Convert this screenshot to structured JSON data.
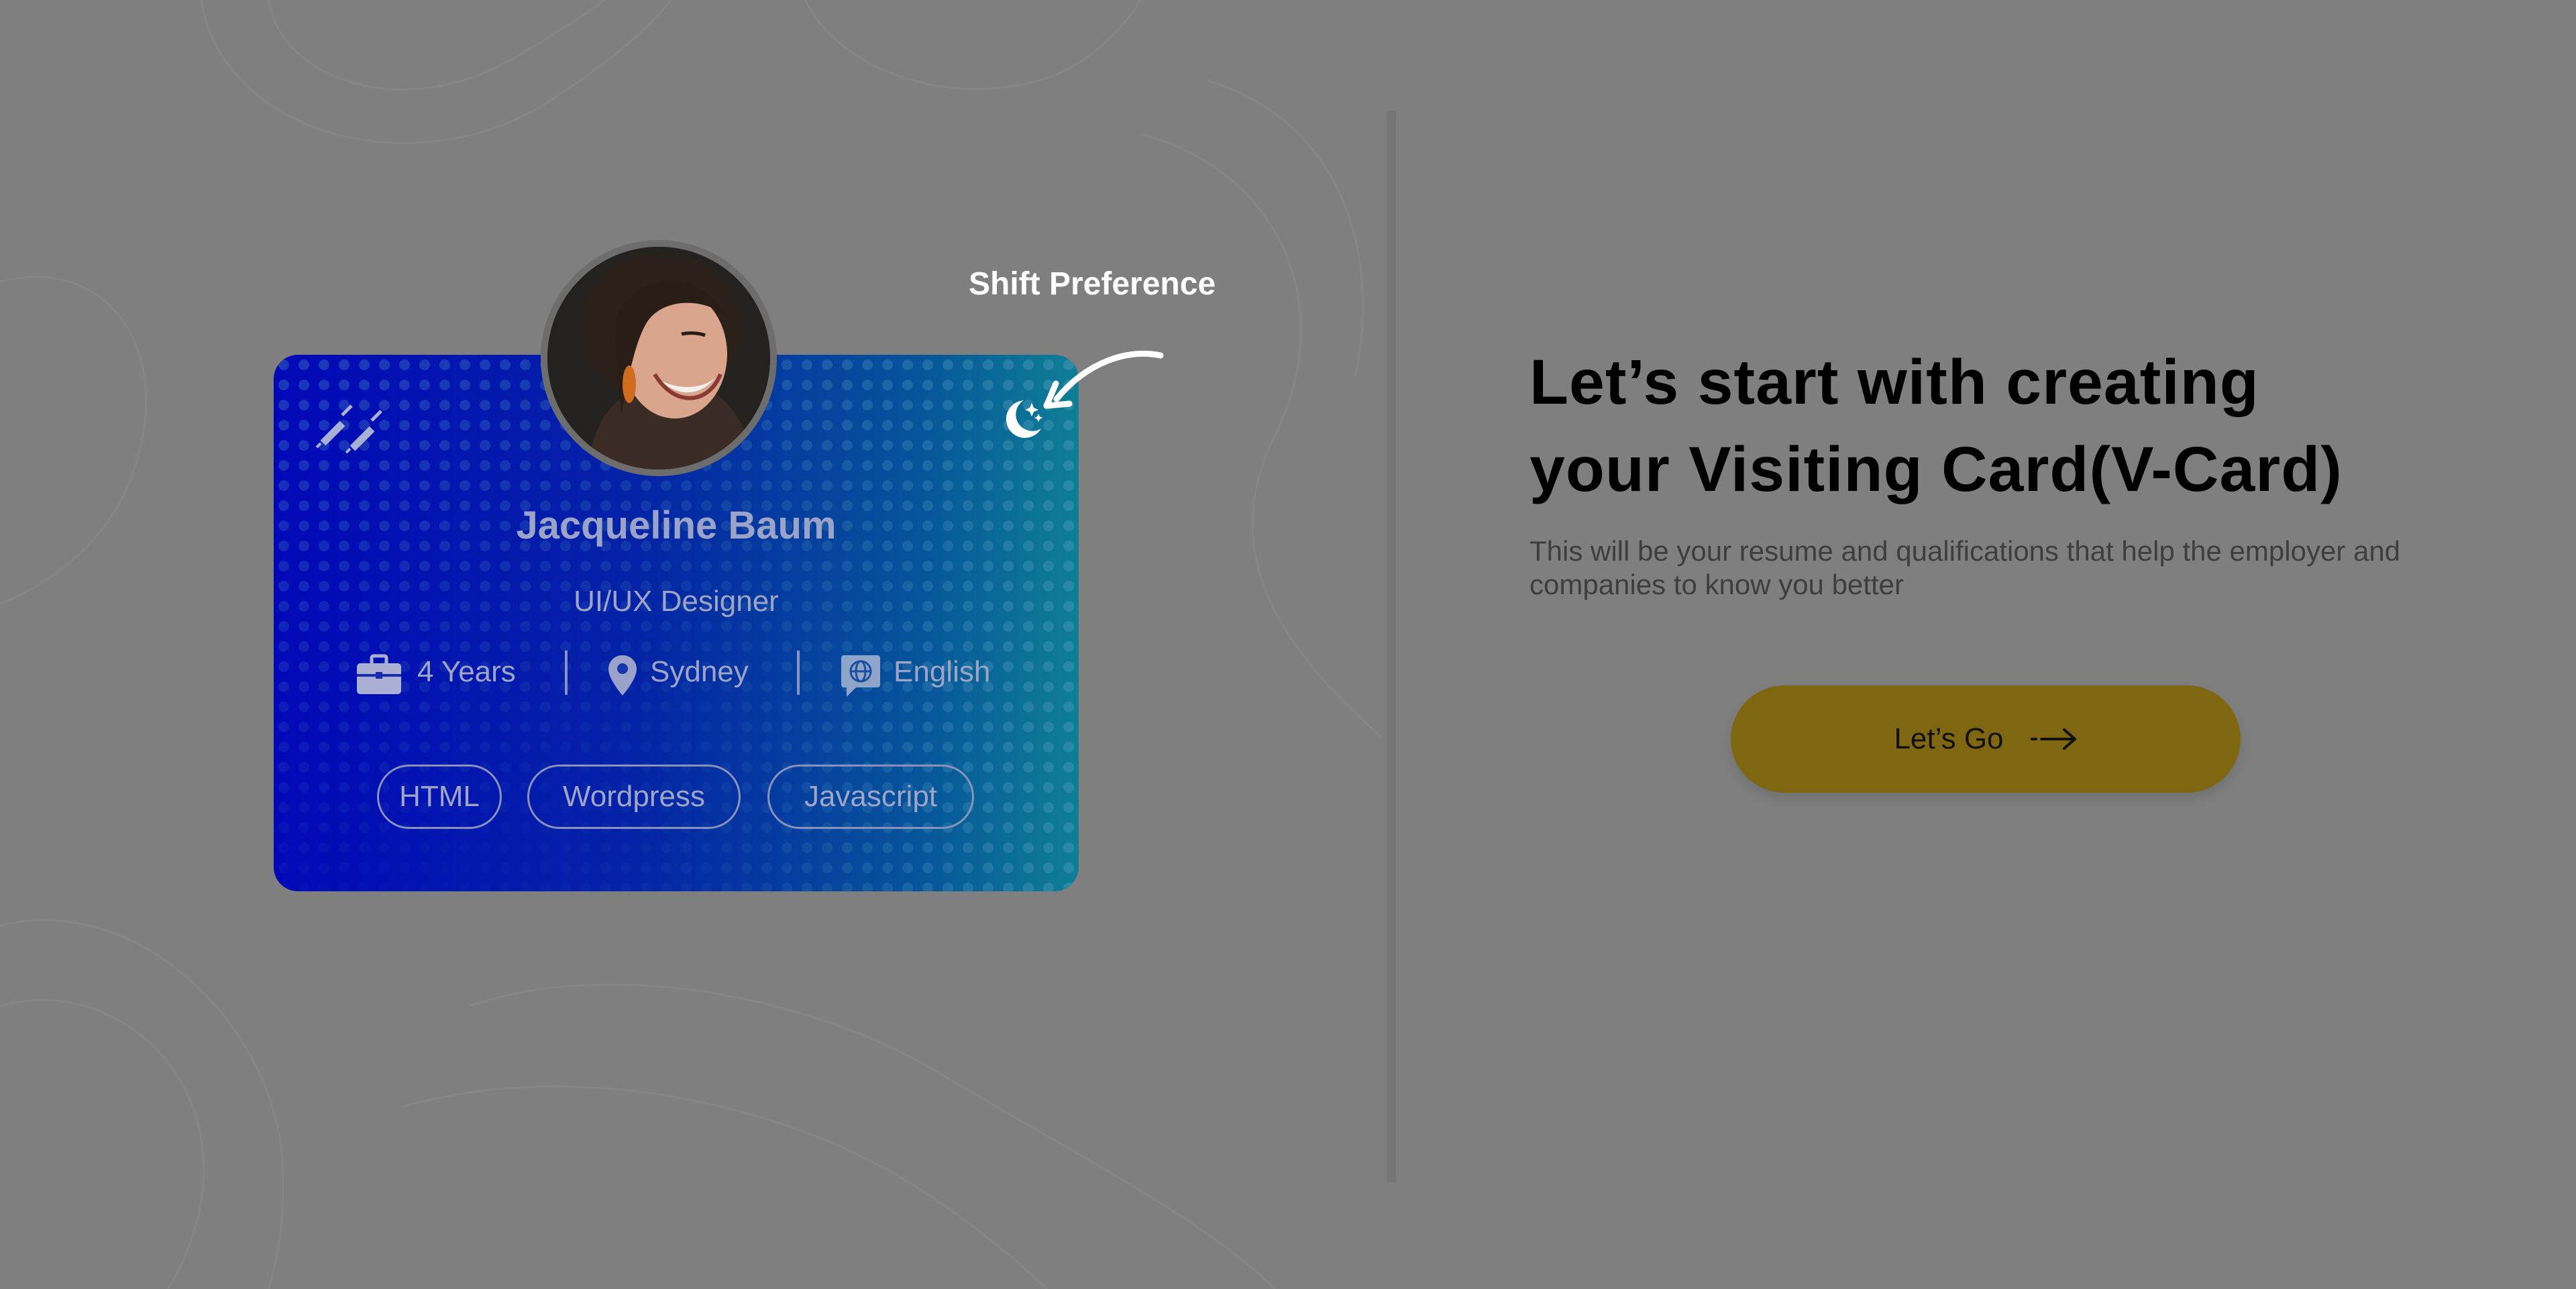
{
  "hint": {
    "label": "Shift Preference"
  },
  "card": {
    "name": "Jacqueline Baum",
    "role": "UI/UX Designer",
    "experience": "4 Years",
    "location": "Sydney",
    "language": "English",
    "skills": [
      "HTML",
      "Wordpress",
      "Javascript"
    ],
    "icons": {
      "top_left": "syringes-icon",
      "top_right": "moon-stars-icon",
      "experience": "briefcase-icon",
      "location": "map-pin-icon",
      "language": "globe-chat-icon"
    },
    "gradient": [
      "#0208b8",
      "#0f7f95"
    ]
  },
  "intro": {
    "headline_line1": "Let’s start with creating",
    "headline_line2": "your Visiting Card(V-Card)",
    "description": "This will be your resume and qualifications that help the employer and companies to know you better",
    "cta_label": "Let’s Go",
    "cta_color": "#7f6611"
  }
}
